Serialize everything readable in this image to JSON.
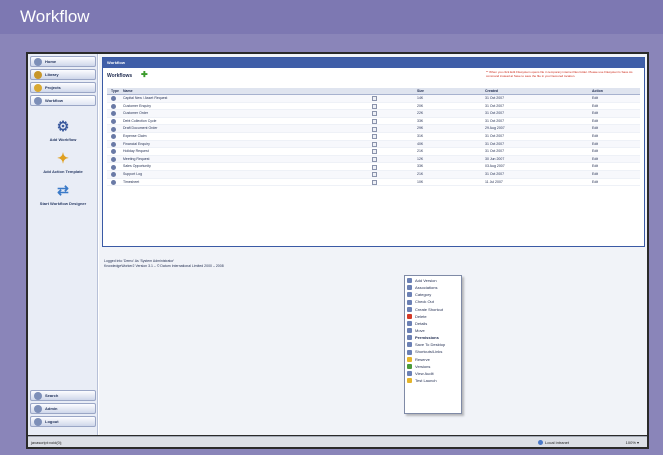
{
  "banner": {
    "title": "Workflow"
  },
  "sidebar": {
    "top_items": [
      {
        "label": "Home",
        "icon": "home-icon"
      },
      {
        "label": "Library",
        "icon": "library-icon"
      },
      {
        "label": "Projects",
        "icon": "projects-icon"
      },
      {
        "label": "Workflow",
        "icon": "workflow-icon"
      }
    ],
    "tools": [
      {
        "label": "Add Workflow",
        "icon": "add-workflow-icon"
      },
      {
        "label": "Add Action Template",
        "icon": "add-action-template-icon"
      },
      {
        "label": "Start Workflow Designer",
        "icon": "workflow-designer-icon"
      }
    ],
    "bottom_items": [
      {
        "label": "Search",
        "icon": "search-icon"
      },
      {
        "label": "Admin",
        "icon": "admin-icon"
      },
      {
        "label": "Logout",
        "icon": "logout-icon"
      }
    ]
  },
  "panel": {
    "header": "Workflow",
    "title": "Workflows",
    "notice": "** When you click Edit Filesystem opens file in temporary internet files folder. Please use Filesystem's Save As command instead at Save to save the file in your favoured location.",
    "columns": {
      "type": "Type",
      "name": "Name",
      "size": "Size",
      "created": "Created",
      "action": "Action"
    },
    "rows": [
      {
        "name": "Capital New / Asset Request",
        "size": "14K",
        "created": "31 Oct 2007",
        "action": "Edit"
      },
      {
        "name": "Customer Enquiry",
        "size": "20K",
        "created": "31 Oct 2007",
        "action": "Edit"
      },
      {
        "name": "Customer Order",
        "size": "22K",
        "created": "31 Oct 2007",
        "action": "Edit"
      },
      {
        "name": "Debt Collection Cycle",
        "size": "33K",
        "created": "31 Oct 2007",
        "action": "Edit"
      },
      {
        "name": "Draft Document Order",
        "size": "29K",
        "created": "29 Aug 2007",
        "action": "Edit"
      },
      {
        "name": "Expense Claim",
        "size": "31K",
        "created": "31 Oct 2007",
        "action": "Edit"
      },
      {
        "name": "Financial Enquiry",
        "size": "40K",
        "created": "31 Oct 2007",
        "action": "Edit"
      },
      {
        "name": "Holiday Request",
        "size": "21K",
        "created": "31 Oct 2007",
        "action": "Edit"
      },
      {
        "name": "Meeting Request",
        "size": "12K",
        "created": "30 Jun 2007",
        "action": "Edit"
      },
      {
        "name": "Sales Opportunity",
        "size": "33K",
        "created": "03 Aug 2007",
        "action": "Edit"
      },
      {
        "name": "Support Log",
        "size": "21K",
        "created": "31 Oct 2007",
        "action": "Edit"
      },
      {
        "name": "Timesheet",
        "size": "10K",
        "created": "11 Jul 2007",
        "action": "Edit"
      }
    ]
  },
  "footer": {
    "line1": "Logged into 'Demo' As 'System Administrator'",
    "line2": "KnowledgeWorker2 Version 3.1 – © Datum International Limited 2000 – 2008"
  },
  "context_menu": [
    {
      "label": "Add Version",
      "icon": "add-version-icon",
      "color": "blue"
    },
    {
      "label": "Associations",
      "icon": "associations-icon",
      "color": "blue"
    },
    {
      "label": "Category",
      "icon": "category-icon",
      "color": "blue"
    },
    {
      "label": "Check Out",
      "icon": "check-out-icon",
      "color": "blue"
    },
    {
      "label": "Create Shortcut",
      "icon": "create-shortcut-icon",
      "color": "blue"
    },
    {
      "label": "Delete",
      "icon": "delete-icon",
      "color": "red"
    },
    {
      "label": "Details",
      "icon": "details-icon",
      "color": "blue"
    },
    {
      "label": "Move",
      "icon": "move-icon",
      "color": "blue"
    },
    {
      "label": "Permissions",
      "icon": "permissions-icon",
      "color": "blue",
      "bold": true
    },
    {
      "label": "Save To Desktop",
      "icon": "save-to-desktop-icon",
      "color": "blue"
    },
    {
      "label": "Shortcuts/Links",
      "icon": "shortcuts-links-icon",
      "color": "blue"
    },
    {
      "label": "Reserve",
      "icon": "reserve-icon",
      "color": "yellow"
    },
    {
      "label": "Versions",
      "icon": "versions-icon",
      "color": "green"
    },
    {
      "label": "View Audit",
      "icon": "view-audit-icon",
      "color": "blue"
    },
    {
      "label": "Test Launch",
      "icon": "test-launch-icon",
      "color": "yellow"
    }
  ],
  "statusbar": {
    "left": "javascript:void(0);",
    "zone": "Local intranet",
    "zoom": "100%"
  }
}
